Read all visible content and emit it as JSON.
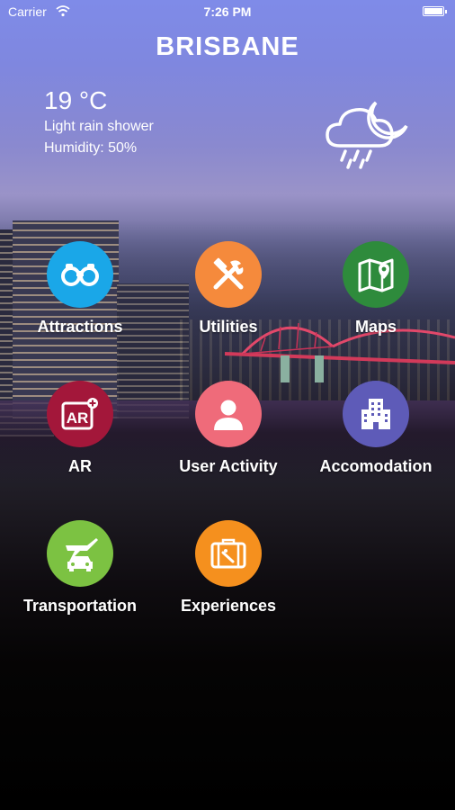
{
  "status_bar": {
    "carrier": "Carrier",
    "time": "7:26 PM"
  },
  "header": {
    "city": "BRISBANE"
  },
  "weather": {
    "temperature": "19 °C",
    "condition": "Light rain shower",
    "humidity": "Humidity: 50%",
    "icon": "cloud-rain-moon-icon"
  },
  "menu": [
    {
      "label": "Attractions",
      "icon": "binoculars-icon",
      "color": "#1aa7e8"
    },
    {
      "label": "Utilities",
      "icon": "tools-icon",
      "color": "#f58a3c"
    },
    {
      "label": "Maps",
      "icon": "map-pin-icon",
      "color": "#2e8b3c"
    },
    {
      "label": "AR",
      "icon": "ar-icon",
      "color": "#a3173a"
    },
    {
      "label": "User Activity",
      "icon": "user-icon",
      "color": "#ef6b7a"
    },
    {
      "label": "Accomodation",
      "icon": "building-icon",
      "color": "#5e5bb8"
    },
    {
      "label": "Transportation",
      "icon": "plane-car-icon",
      "color": "#7cc242"
    },
    {
      "label": "Experiences",
      "icon": "suitcase-icon",
      "color": "#f5901e"
    }
  ]
}
